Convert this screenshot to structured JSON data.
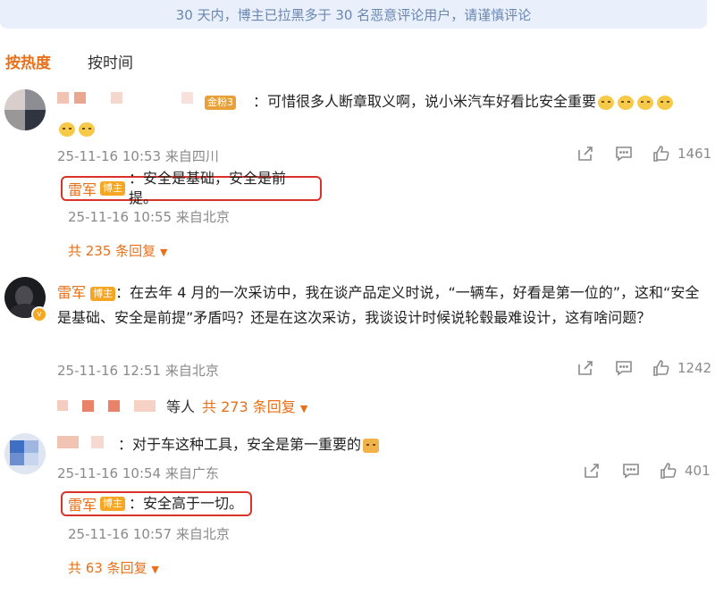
{
  "notice": "30 天内，博主已拉黑多于 30 名恶意评论用户，请谨慎评论",
  "tabs": [
    {
      "label": "按热度",
      "active": true
    },
    {
      "label": "按时间",
      "active": false
    }
  ],
  "comments": [
    {
      "fan_badge": "金粉3",
      "text": "：可惜很多人断章取义啊，说小米汽车好看比安全重要",
      "meta": "25-11-16 10:53 来自四川",
      "likes": "1461",
      "reply": {
        "name": "雷军",
        "badge": "博主",
        "text": "：安全是基础，安全是前提。",
        "meta": "25-11-16 10:55 来自北京"
      },
      "more": "共 235 条回复"
    },
    {
      "name": "雷军",
      "badge": "博主",
      "text": "：在去年 4 月的一次采访中，我在谈产品定义时说，“一辆车，好看是第一位的”，这和“安全是基础、安全是前提”矛盾吗？还是在这次采访，我谈设计时候说轮毂最难设计，这有啥问题？",
      "meta": "25-11-16 12:51 来自北京",
      "likes": "1242",
      "others_label": "等人",
      "more": "共 273 条回复"
    },
    {
      "text": "：对于车这种工具，安全是第一重要的",
      "meta": "25-11-16 10:54 来自广东",
      "likes": "401",
      "reply": {
        "name": "雷军",
        "badge": "博主",
        "text": "：安全高于一切。",
        "meta": "25-11-16 10:57 来自北京"
      },
      "more": "共 63 条回复"
    }
  ],
  "colors": {
    "accent": "#e8701a",
    "highlight_border": "#d9342b",
    "badge": "#f5a623"
  }
}
